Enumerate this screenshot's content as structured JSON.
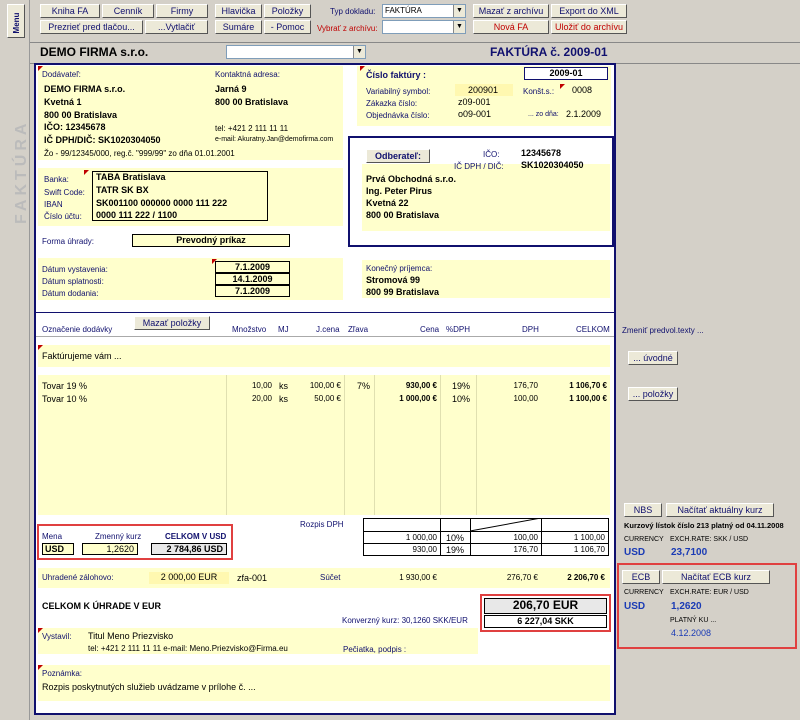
{
  "app": {
    "menu": "Menu"
  },
  "toolbar": {
    "kniha_fa": "Kniha FA",
    "cennik": "Cenník",
    "firmy": "Firmy",
    "hlavicka": "Hlavička",
    "polozky": "Položky",
    "prezriet": "Prezrieť pred tlačou...",
    "vytlacit": "...Vytlačiť",
    "sumare": "Sumáre",
    "pomoc": "- Pomoc",
    "typ_label": "Typ dokladu:",
    "typ_value": "FAKTÚRA",
    "archiv_label": "Vybrať z archívu:",
    "archiv_value": "",
    "mazat_archiv": "Mazať z archívu",
    "export_xml": "Export do XML",
    "nova_fa": "Nová FA",
    "ulozit": "Uložiť do archívu"
  },
  "header": {
    "company": "DEMO FIRMA s.r.o.",
    "company_select": "",
    "title": "FAKTÚRA č. 2009-01",
    "side": "FAKTÚRA"
  },
  "supplier": {
    "label": "Dodávateľ:",
    "name": "DEMO FIRMA s.r.o.",
    "street": "Kvetná 1",
    "city": "800 00 Bratislava",
    "ico": "IČO: 12345678",
    "dic": "IČ DPH/DIČ: SK1020304050",
    "register": "Žo - 99/12345/000, reg.č. \"999/99\" zo dňa 01.01.2001",
    "contact_label": "Kontaktná adresa:",
    "contact_street": "Jarná 9",
    "contact_city": "800 00 Bratislava",
    "tel": "tel: +421 2 111 11 11",
    "email": "e-mail: Akuratny.Jan@demofirma.com"
  },
  "bank": {
    "banka_label": "Banka:",
    "banka": "TABA Bratislava",
    "swift_label": "Swift Code:",
    "swift": "TATR SK BX",
    "iban_label": "IBAN",
    "iban": "SK001100 000000 0000 111 222",
    "ucet_label": "Číslo účtu:",
    "ucet": "0000 111 222 / 1100"
  },
  "payment": {
    "label": "Forma úhrady:",
    "value": "Prevodný príkaz"
  },
  "dates": {
    "vyst_label": "Dátum vystavenia:",
    "vyst": "7.1.2009",
    "splat_label": "Dátum splatnosti:",
    "splat": "14.1.2009",
    "dod_label": "Dátum dodania:",
    "dod": "7.1.2009"
  },
  "invoice": {
    "cislo_label": "Číslo faktúry :",
    "cislo": "2009-01",
    "vs_label": "Variabilný symbol:",
    "vs": "200901",
    "ks_label": "Konšt.s.:",
    "ks": "0008",
    "zak_label": "Zákazka číslo:",
    "zak": "z09-001",
    "obj_label": "Objednávka číslo:",
    "obj": "o09-001",
    "zodna_label": "... zo dňa:",
    "zodna": "2.1.2009"
  },
  "customer": {
    "button": "Odberateľ:",
    "ico_label": "IČO:",
    "ico": "12345678",
    "dic_label": "IČ DPH / DIČ:",
    "dic": "SK1020304050",
    "name": "Prvá Obchodná s.r.o.",
    "person": "Ing. Peter Pirus",
    "street": "Kvetná 22",
    "city": "800 00 Bratislava"
  },
  "recipient": {
    "label": "Konečný príjemca:",
    "street": "Stromová 99",
    "city": "800 99 Bratislava"
  },
  "items": {
    "mazat": "Mazať položky",
    "headers": [
      "Označenie dodávky",
      "Množstvo",
      "MJ",
      "J.cena",
      "Zľava",
      "Cena",
      "%DPH",
      "DPH",
      "CELKOM"
    ],
    "intro": "Faktúrujeme vám ...",
    "rows": [
      {
        "name": "Tovar 19 %",
        "qty": "10,00",
        "mj": "ks",
        "price": "100,00 €",
        "disc": "7%",
        "cena": "930,00 €",
        "pct": "19%",
        "dph": "176,70",
        "total": "1 106,70 €"
      },
      {
        "name": "Tovar 10 %",
        "qty": "20,00",
        "mj": "ks",
        "price": "50,00 €",
        "disc": "",
        "cena": "1 000,00 €",
        "pct": "10%",
        "dph": "100,00",
        "total": "1 100,00 €"
      }
    ]
  },
  "right": {
    "zmenit": "Zmeniť predvol.texty ...",
    "uvodne": "... úvodné",
    "polozky": "... položky"
  },
  "currency": {
    "mena_label": "Mena",
    "mena": "USD",
    "kurz_label": "Zmenný kurz",
    "kurz": "1,2620",
    "celkom_label": "CELKOM V USD",
    "celkom": "2 784,86 USD"
  },
  "dph_summary": {
    "label": "Rozpis DPH",
    "rows": [
      {
        "base": "1 000,00",
        "pct": "10%",
        "dph": "100,00",
        "total": "1 100,00"
      },
      {
        "base": "930,00",
        "pct": "19%",
        "dph": "176,70",
        "total": "1 106,70"
      }
    ]
  },
  "totals": {
    "zalohy_label": "Uhradené zálohovo:",
    "zalohy": "2 000,00 EUR",
    "zfa": "zfa-001",
    "sucet_label": "Súčet",
    "sucet_base": "1 930,00 €",
    "sucet_dph": "276,70 €",
    "sucet_total": "2 206,70 €",
    "celkom_label": "CELKOM K ÚHRADE V EUR",
    "celkom_eur": "206,70 EUR",
    "konv_label": "Konverzný kurz: 30,1260 SKK/EUR",
    "celkom_skk": "6 227,04 SKK"
  },
  "issuer": {
    "label": "Vystavil:",
    "name": "Titul Meno Priezvisko",
    "contact": "tel: +421 2 111 11 11 e-mail: Meno.Priezvisko@Firma.eu",
    "stamp": "Pečiatka, podpis :"
  },
  "note": {
    "label": "Poznámka:",
    "text": "Rozpis poskytnutých služieb uvádzame v prílohe č. ..."
  },
  "nbs": {
    "button": "NBS",
    "nacitat": "Načítať aktuálny kurz",
    "listok": "Kurzový lístok číslo 213 platný od 04.11.2008",
    "currency_label": "CURRENCY",
    "rate_label": "EXCH.RATE: SKK / USD",
    "currency": "USD",
    "rate": "23,7100"
  },
  "ecb": {
    "button": "ECB",
    "nacitat": "Načítať ECB kurz",
    "currency_label": "CURRENCY",
    "rate_label": "EXCH.RATE: EUR / USD",
    "currency": "USD",
    "rate": "1,2620",
    "platny_label": "PLATNÝ KU ...",
    "platny": "4.12.2008"
  }
}
